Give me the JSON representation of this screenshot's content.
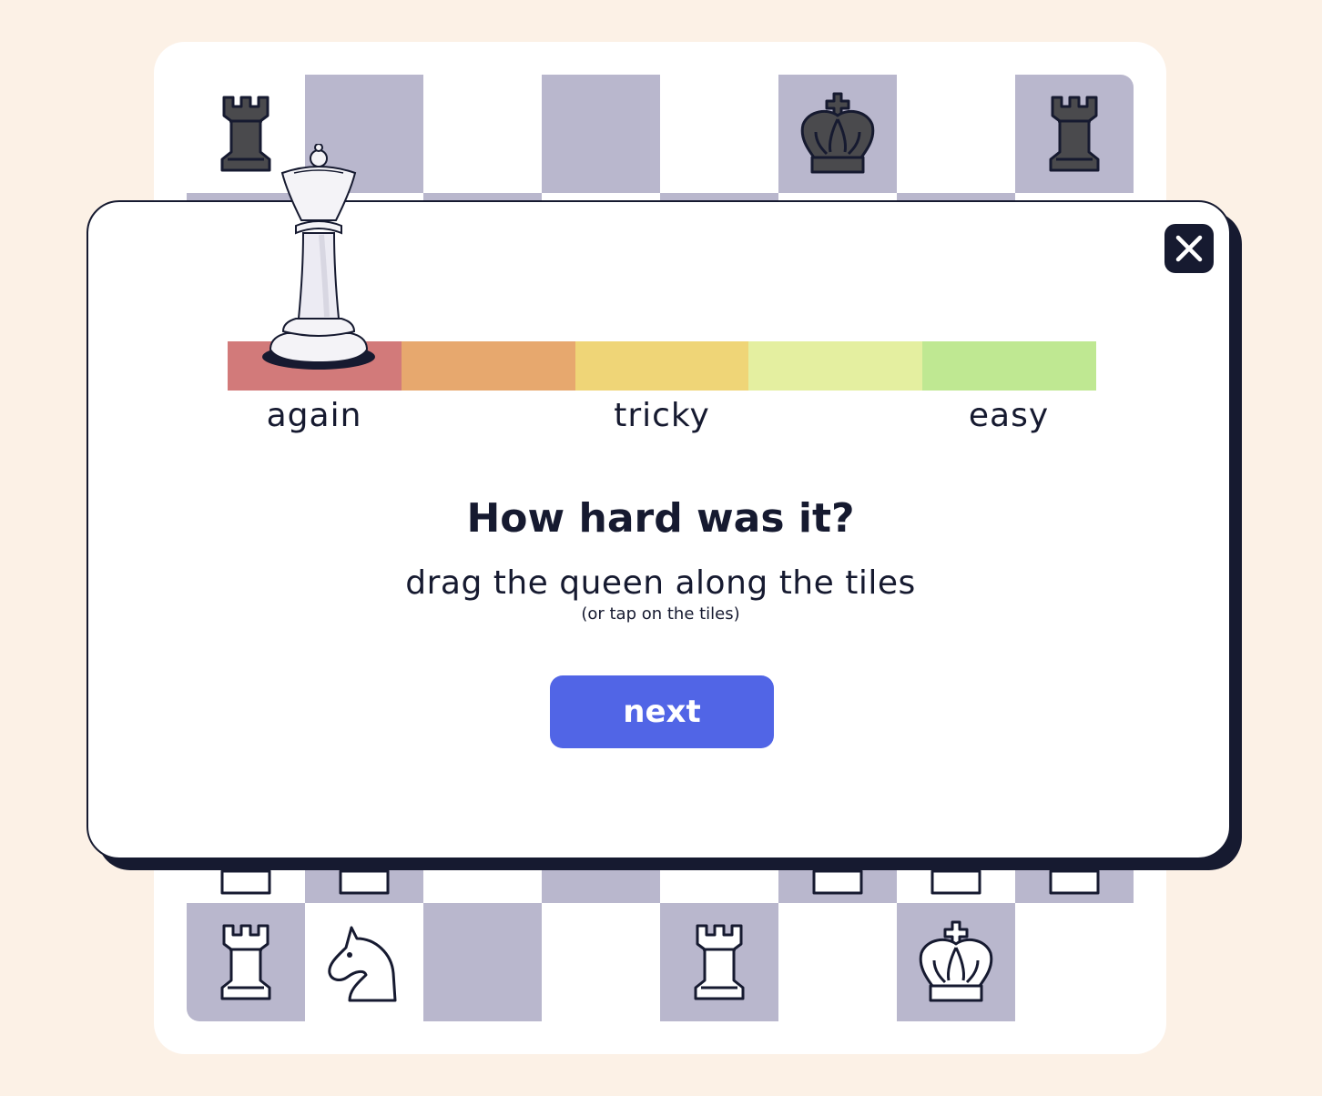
{
  "colors": {
    "background": "#fcf1e6",
    "board_dark": "#b9b7cd",
    "board_light": "#ffffff",
    "ink": "#161a30",
    "accent": "#5165e6"
  },
  "board": {
    "rows": [
      [
        "black-rook",
        "",
        "",
        "",
        "",
        "black-king",
        "",
        "black-rook"
      ],
      [
        "",
        "",
        "",
        "",
        "",
        "",
        "",
        ""
      ],
      [
        "",
        "",
        "",
        "",
        "",
        "",
        "",
        ""
      ],
      [
        "",
        "",
        "",
        "",
        "",
        "",
        "",
        ""
      ],
      [
        "",
        "",
        "",
        "",
        "",
        "",
        "",
        ""
      ],
      [
        "",
        "",
        "",
        "",
        "",
        "",
        "",
        ""
      ],
      [
        "white-pawn",
        "white-pawn",
        "",
        "",
        "",
        "white-pawn",
        "white-pawn",
        "white-pawn"
      ],
      [
        "white-rook",
        "white-knight",
        "",
        "",
        "white-rook",
        "",
        "white-king",
        ""
      ]
    ]
  },
  "modal": {
    "close_icon": "close-icon",
    "tiles": [
      {
        "id": "again",
        "color": "#d27a7a"
      },
      {
        "id": "hard",
        "color": "#e7a86e"
      },
      {
        "id": "tricky",
        "color": "#efd577"
      },
      {
        "id": "good",
        "color": "#e4efa0"
      },
      {
        "id": "easy",
        "color": "#bfe892"
      }
    ],
    "labels": {
      "again": "again",
      "tricky": "tricky",
      "easy": "easy"
    },
    "selected_tile": "again",
    "question": "How hard was it?",
    "instruction": "drag the queen along the tiles",
    "hint": "(or tap on the tiles)",
    "next_label": "next"
  }
}
